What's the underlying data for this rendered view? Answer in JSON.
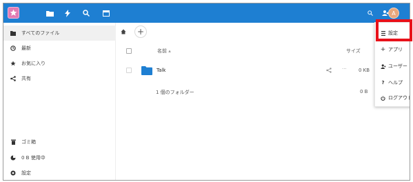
{
  "header": {
    "avatar_letter": "A",
    "nav_icons": [
      "files-icon",
      "activity-icon",
      "search-icon",
      "calendar-icon"
    ],
    "right_icons": [
      "search-icon",
      "users-icon"
    ],
    "bg_color": "#1e7fd2"
  },
  "sidebar": {
    "items": [
      {
        "label": "すべてのファイル",
        "icon": "folder-icon"
      },
      {
        "label": "最新",
        "icon": "clock-icon"
      },
      {
        "label": "お気に入り",
        "icon": "star-icon"
      },
      {
        "label": "共有",
        "icon": "share-icon"
      }
    ],
    "bottom_items": [
      {
        "label": "ゴミ箱",
        "icon": "trash-icon"
      },
      {
        "label": "0 B 使用中",
        "icon": "pie-icon"
      },
      {
        "label": "設定",
        "icon": "gear-icon"
      }
    ]
  },
  "main": {
    "columns": {
      "name": "名前",
      "sort_arrow": "▴",
      "size": "サイズ"
    },
    "files": [
      {
        "name": "Talk",
        "size": "0 KB"
      }
    ],
    "summary": {
      "text": "1 個のフォルダー",
      "size": "0 B"
    }
  },
  "menu": {
    "items": [
      {
        "label": "設定",
        "icon": "gear-icon"
      },
      {
        "label": "アプリ",
        "icon": "plus-icon"
      },
      {
        "label": "ユーザー",
        "icon": "users-icon"
      },
      {
        "label": "ヘルプ",
        "icon": "help-icon"
      },
      {
        "label": "ログアウト",
        "icon": "power-icon"
      }
    ],
    "highlight_color": "#e8111a"
  }
}
